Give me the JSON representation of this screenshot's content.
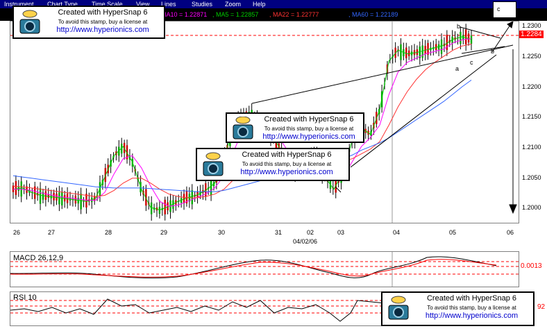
{
  "menu": [
    "Instrument",
    "Chart Type",
    "Time Scale",
    "View",
    "Lines",
    "Studies",
    "Zoom",
    "Help"
  ],
  "legend": [
    {
      "label": "MA10",
      "value": "1.22871",
      "color": "#ff00ff"
    },
    {
      "label": "MA5",
      "value": "1.22857",
      "color": "#00cc00"
    },
    {
      "label": "MA22",
      "value": "1.22777",
      "color": "#ff3333"
    },
    {
      "label": "MA60",
      "value": "1.22189",
      "color": "#3366ff"
    }
  ],
  "stamp": {
    "line1": "Created with HyperSnap 6",
    "line2": "To avoid this stamp, buy a license at",
    "line3": "http://www.hyperionics.com"
  },
  "price_tag": "1.2284",
  "macd_label": "MACD 26,12,9",
  "macd_value": "0.0013",
  "rsi_label": "RSI 10",
  "rsi_value": "92",
  "date_caption": "04/02/06",
  "pattern_labels": {
    "a": "a",
    "b": "b",
    "c": "c"
  },
  "chart_data": {
    "type": "line",
    "x_ticks": [
      "26",
      "27",
      "28",
      "29",
      "30",
      "31",
      "02",
      "03",
      "04",
      "05",
      "06"
    ],
    "y_ticks": [
      "1.2300",
      "1.2250",
      "1.2200",
      "1.2150",
      "1.2100",
      "1.2050",
      "1.2000"
    ],
    "ylim": [
      1.1985,
      1.2315
    ],
    "series": [
      {
        "name": "MA5",
        "color": "#00cc00",
        "values": [
          1.204,
          1.2042,
          1.2035,
          1.203,
          1.2028,
          1.2026,
          1.2024,
          1.2022,
          1.202,
          1.2025,
          1.206,
          1.2095,
          1.211,
          1.2085,
          1.204,
          1.201,
          1.2006,
          1.2012,
          1.202,
          1.2026,
          1.203,
          1.2038,
          1.205,
          1.209,
          1.214,
          1.2162,
          1.216,
          1.2145,
          1.2135,
          1.211,
          1.208,
          1.207,
          1.2085,
          1.2095,
          1.206,
          1.204,
          1.2068,
          1.212,
          1.214,
          1.213,
          1.217,
          1.225,
          1.2268,
          1.2262,
          1.2264,
          1.2268,
          1.2272,
          1.2276,
          1.2286,
          1.229,
          1.2286
        ]
      },
      {
        "name": "MA10",
        "color": "#ff00ff",
        "values": [
          1.204,
          1.204,
          1.2038,
          1.2034,
          1.2031,
          1.2028,
          1.2026,
          1.2024,
          1.2022,
          1.2022,
          1.2035,
          1.2065,
          1.209,
          1.2095,
          1.2075,
          1.2045,
          1.202,
          1.2012,
          1.2014,
          1.202,
          1.2026,
          1.2032,
          1.2042,
          1.2062,
          1.21,
          1.2135,
          1.215,
          1.215,
          1.214,
          1.2125,
          1.2102,
          1.209,
          1.2085,
          1.209,
          1.2082,
          1.206,
          1.206,
          1.2085,
          1.211,
          1.2125,
          1.2145,
          1.2195,
          1.2232,
          1.2248,
          1.2255,
          1.2262,
          1.2266,
          1.227,
          1.228,
          1.2285,
          1.2287
        ]
      },
      {
        "name": "MA22",
        "color": "#ff3333",
        "values": [
          1.2045,
          1.2044,
          1.2042,
          1.204,
          1.2038,
          1.2036,
          1.2034,
          1.2032,
          1.203,
          1.2028,
          1.203,
          1.2038,
          1.205,
          1.2058,
          1.2058,
          1.205,
          1.204,
          1.2032,
          1.2028,
          1.2026,
          1.2026,
          1.2028,
          1.2032,
          1.204,
          1.2055,
          1.2075,
          1.209,
          1.21,
          1.2106,
          1.2108,
          1.2106,
          1.2102,
          1.2098,
          1.2096,
          1.2092,
          1.2088,
          1.2086,
          1.209,
          1.2098,
          1.2106,
          1.2118,
          1.2145,
          1.2175,
          1.22,
          1.222,
          1.2236,
          1.2248,
          1.2258,
          1.2268,
          1.2275,
          1.2278
        ]
      },
      {
        "name": "MA60",
        "color": "#3366ff",
        "values": [
          1.2062,
          1.206,
          1.2058,
          1.2056,
          1.2054,
          1.2052,
          1.205,
          1.2048,
          1.2046,
          1.2044,
          1.2043,
          1.2042,
          1.2042,
          1.2042,
          1.2042,
          1.2041,
          1.204,
          1.2039,
          1.2038,
          1.2037,
          1.2036,
          1.2036,
          1.2036,
          1.2038,
          1.2042,
          1.2046,
          1.205,
          1.2054,
          1.2058,
          1.2062,
          1.2066,
          1.207,
          1.2074,
          1.2078,
          1.2082,
          1.2086,
          1.209,
          1.2096,
          1.2104,
          1.211,
          1.2116,
          1.2124,
          1.2134,
          1.2144,
          1.2154,
          1.2164,
          1.2174,
          1.2184,
          1.2196,
          1.2208,
          1.2219
        ]
      }
    ]
  }
}
